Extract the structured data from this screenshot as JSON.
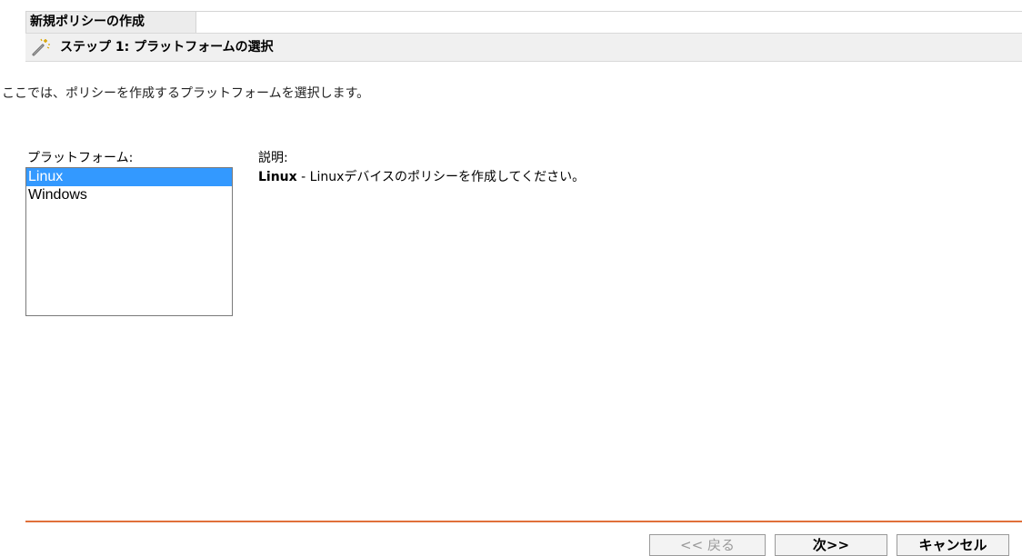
{
  "wizard": {
    "title": "新規ポリシーの作成",
    "step_title": "ステップ 1: プラットフォームの選択",
    "step_icon": "magic-wand-icon",
    "intro": "ここでは、ポリシーを作成するプラットフォームを選択します。"
  },
  "platform": {
    "label": "プラットフォーム:",
    "options": [
      "Linux",
      "Windows"
    ],
    "selected": "Linux"
  },
  "description": {
    "label": "説明:",
    "name": "Linux",
    "separator": " - ",
    "text": "Linuxデバイスのポリシーを作成してください。"
  },
  "buttons": {
    "back": "<< 戻る",
    "next": "次>>",
    "cancel": "キャンセル"
  },
  "colors": {
    "accent": "#e0703a",
    "selection": "#3399ff",
    "step_bar": "#f0f0f0"
  }
}
